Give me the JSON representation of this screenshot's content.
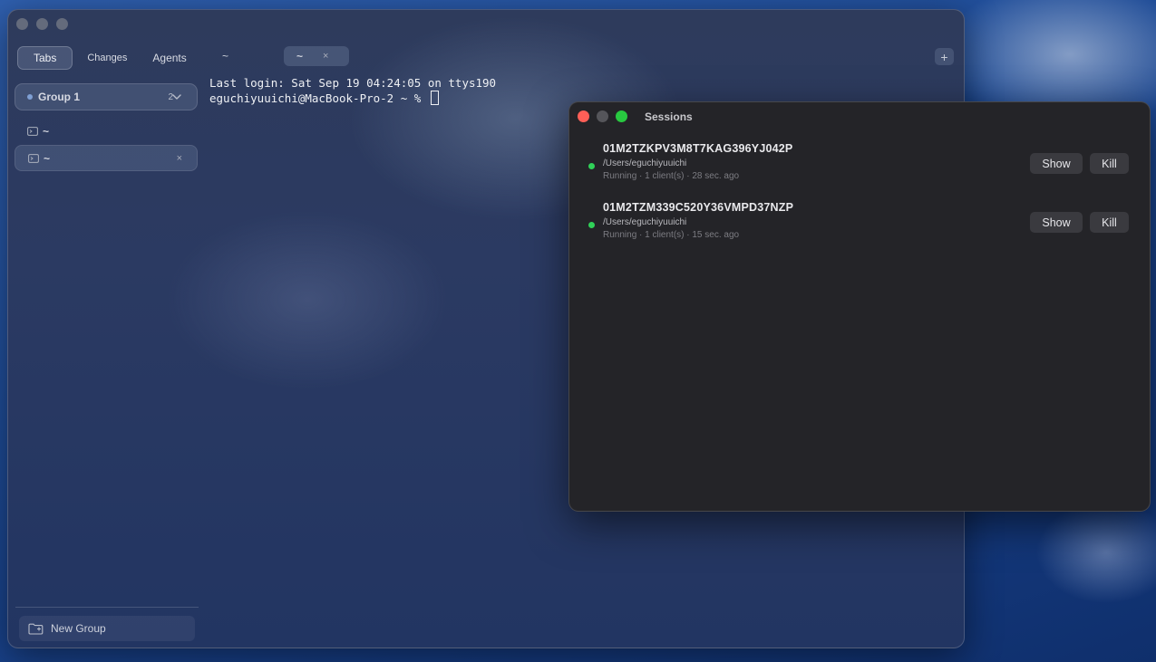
{
  "main_window": {
    "sidebar": {
      "segments": [
        {
          "label": "Tabs"
        },
        {
          "label": "Changes"
        },
        {
          "label": "Agents"
        }
      ],
      "group": {
        "label": "Group 1",
        "count": "2"
      },
      "tabs": [
        {
          "label": "~"
        },
        {
          "label": "~",
          "close": "×"
        }
      ],
      "new_group_label": "New Group"
    },
    "terminal_tabs": [
      {
        "label": "~"
      },
      {
        "label": "~",
        "close": "×"
      }
    ],
    "add_tab_label": "+",
    "terminal": {
      "line1": "Last login: Sat Sep 19 04:24:05 on ttys190",
      "line2": "eguchiyuuichi@MacBook-Pro-2 ~ % "
    }
  },
  "sessions_window": {
    "title": "Sessions",
    "sessions": [
      {
        "id": "01M2TZKPV3M8T7KAG396YJ042P",
        "path": "/Users/eguchiyuuichi",
        "meta": "Running · 1 client(s) · 28 sec. ago",
        "show_label": "Show",
        "kill_label": "Kill"
      },
      {
        "id": "01M2TZM339C520Y36VMPD37NZP",
        "path": "/Users/eguchiyuuichi",
        "meta": "Running · 1 client(s) · 15 sec. ago",
        "show_label": "Show",
        "kill_label": "Kill"
      }
    ],
    "status_color": "#30d158"
  }
}
